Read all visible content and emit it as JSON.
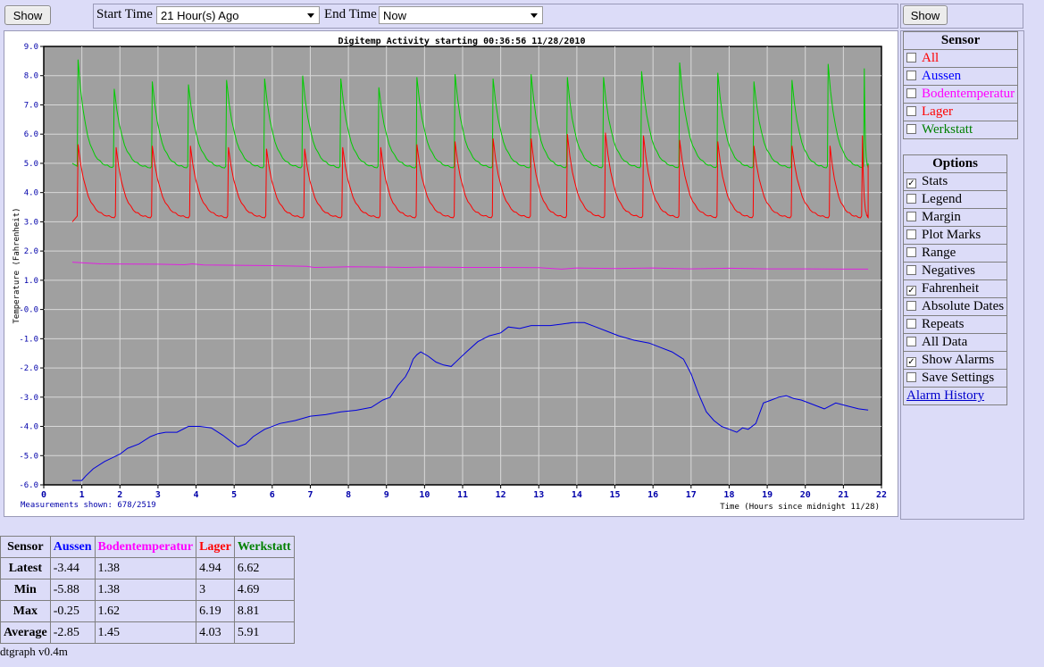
{
  "controls": {
    "show_label": "Show",
    "start_time_label": "Start Time",
    "start_time_value": "21 Hour(s) Ago",
    "end_time_label": "End Time",
    "end_time_value": "Now"
  },
  "sensor_panel": {
    "header": "Sensor",
    "items": [
      {
        "label": "All",
        "color": "#ff0000",
        "checked": false
      },
      {
        "label": "Aussen",
        "color": "#0000ff",
        "checked": false
      },
      {
        "label": "Bodentemperatur",
        "color": "#ff00ff",
        "checked": false
      },
      {
        "label": "Lager",
        "color": "#ff0000",
        "checked": false
      },
      {
        "label": "Werkstatt",
        "color": "#008000",
        "checked": false
      }
    ]
  },
  "options_panel": {
    "header": "Options",
    "items": [
      {
        "label": "Stats",
        "checked": true
      },
      {
        "label": "Legend",
        "checked": false
      },
      {
        "label": "Margin",
        "checked": false
      },
      {
        "label": "Plot Marks",
        "checked": false
      },
      {
        "label": "Range",
        "checked": false
      },
      {
        "label": "Negatives",
        "checked": false
      },
      {
        "label": "Fahrenheit",
        "checked": true
      },
      {
        "label": "Absolute Dates",
        "checked": false
      },
      {
        "label": "Repeats",
        "checked": false
      },
      {
        "label": "All Data",
        "checked": false
      },
      {
        "label": "Show Alarms",
        "checked": true
      },
      {
        "label": "Save Settings",
        "checked": false
      }
    ],
    "alarm_history": "Alarm History"
  },
  "chart_data": {
    "type": "line",
    "title": "Digitemp Activity starting 00:36:56 11/28/2010",
    "xlabel": "Time (Hours since midnight 11/28)",
    "ylabel": "Temperature (Fahrenheit)",
    "footnote": "Measurements shown: 678/2519",
    "xlim": [
      0,
      22
    ],
    "ylim": [
      -6,
      9
    ],
    "xticks": [
      "0",
      "1",
      "2",
      "3",
      "4",
      "5",
      "6",
      "7",
      "8",
      "9",
      "10",
      "11",
      "12",
      "13",
      "14",
      "15",
      "16",
      "17",
      "18",
      "19",
      "20",
      "21",
      "22"
    ],
    "yticks": [
      "-6.0",
      "-5.0",
      "-4.0",
      "-3.0",
      "-2.0",
      "-1.0",
      "-0.0",
      "1.0",
      "2.0",
      "3.0",
      "4.0",
      "5.0",
      "6.0",
      "7.0",
      "8.0",
      "9.0"
    ],
    "grid": true,
    "background": "#a0a0a0",
    "series": [
      {
        "name": "Werkstatt",
        "color": "#00cc00",
        "kind": "sawtooth",
        "peaks": [
          [
            0.9,
            8.55
          ],
          [
            1.85,
            7.55
          ],
          [
            2.85,
            7.8
          ],
          [
            3.8,
            7.7
          ],
          [
            4.8,
            7.85
          ],
          [
            5.8,
            7.9
          ],
          [
            6.8,
            8.0
          ],
          [
            7.8,
            7.9
          ],
          [
            8.8,
            7.6
          ],
          [
            9.8,
            7.95
          ],
          [
            10.8,
            8.05
          ],
          [
            11.8,
            7.9
          ],
          [
            12.8,
            8.05
          ],
          [
            13.75,
            7.95
          ],
          [
            14.7,
            7.95
          ],
          [
            15.7,
            8.15
          ],
          [
            16.7,
            8.45
          ],
          [
            17.7,
            8.1
          ],
          [
            18.65,
            7.8
          ],
          [
            19.65,
            7.85
          ],
          [
            20.6,
            8.4
          ],
          [
            21.55,
            8.25
          ]
        ],
        "start": [
          0.75,
          5.0
        ],
        "base": 4.8,
        "end": [
          21.65,
          5.0
        ]
      },
      {
        "name": "Lager",
        "color": "#ff0000",
        "kind": "sawtooth",
        "peaks": [
          [
            0.9,
            5.65
          ],
          [
            1.9,
            5.55
          ],
          [
            2.85,
            5.6
          ],
          [
            3.85,
            5.6
          ],
          [
            4.85,
            5.55
          ],
          [
            5.85,
            5.5
          ],
          [
            6.85,
            5.5
          ],
          [
            7.85,
            5.55
          ],
          [
            8.85,
            5.55
          ],
          [
            9.8,
            5.65
          ],
          [
            10.8,
            5.75
          ],
          [
            11.8,
            5.85
          ],
          [
            12.8,
            5.85
          ],
          [
            13.75,
            6.0
          ],
          [
            14.75,
            6.05
          ],
          [
            15.75,
            5.95
          ],
          [
            16.7,
            5.8
          ],
          [
            17.7,
            5.75
          ],
          [
            18.65,
            5.6
          ],
          [
            19.65,
            5.6
          ],
          [
            20.65,
            5.6
          ],
          [
            21.5,
            5.95
          ]
        ],
        "start": [
          0.75,
          3.0
        ],
        "base": 3.1,
        "end": [
          21.65,
          4.94
        ]
      },
      {
        "name": "Bodentemperatur",
        "color": "#e020e0",
        "kind": "line",
        "x": [
          0.75,
          1.5,
          3,
          3.7,
          3.9,
          4.2,
          6,
          6.9,
          7.1,
          8,
          9,
          9.5,
          10,
          11,
          12,
          13,
          13.6,
          14,
          15,
          16,
          17,
          18,
          19,
          20,
          21,
          21.65
        ],
        "y": [
          1.62,
          1.56,
          1.55,
          1.53,
          1.56,
          1.52,
          1.5,
          1.48,
          1.44,
          1.46,
          1.45,
          1.44,
          1.45,
          1.44,
          1.44,
          1.43,
          1.38,
          1.42,
          1.4,
          1.42,
          1.39,
          1.41,
          1.39,
          1.39,
          1.38,
          1.38
        ]
      },
      {
        "name": "Aussen",
        "color": "#0000dd",
        "kind": "line",
        "x": [
          0.75,
          1.0,
          1.1,
          1.3,
          1.6,
          2.0,
          2.2,
          2.5,
          2.8,
          3.0,
          3.2,
          3.5,
          3.8,
          4.1,
          4.4,
          4.7,
          4.9,
          5.1,
          5.3,
          5.5,
          5.8,
          6.2,
          6.6,
          7.0,
          7.4,
          7.8,
          8.2,
          8.6,
          8.9,
          9.1,
          9.3,
          9.5,
          9.6,
          9.7,
          9.8,
          9.9,
          10.1,
          10.3,
          10.5,
          10.7,
          10.9,
          11.1,
          11.4,
          11.7,
          12.0,
          12.2,
          12.5,
          12.8,
          13.0,
          13.3,
          13.6,
          13.9,
          14.2,
          14.5,
          14.8,
          15.1,
          15.5,
          15.9,
          16.2,
          16.5,
          16.8,
          17.0,
          17.2,
          17.4,
          17.6,
          17.8,
          18.0,
          18.2,
          18.35,
          18.5,
          18.7,
          18.9,
          19.1,
          19.3,
          19.5,
          19.7,
          19.9,
          20.2,
          20.5,
          20.8,
          21.1,
          21.4,
          21.65
        ],
        "y": [
          -5.85,
          -5.85,
          -5.7,
          -5.45,
          -5.2,
          -4.95,
          -4.75,
          -4.6,
          -4.35,
          -4.25,
          -4.2,
          -4.2,
          -4.0,
          -4.0,
          -4.05,
          -4.3,
          -4.5,
          -4.7,
          -4.6,
          -4.35,
          -4.1,
          -3.9,
          -3.8,
          -3.65,
          -3.6,
          -3.5,
          -3.45,
          -3.35,
          -3.1,
          -3.0,
          -2.6,
          -2.3,
          -2.05,
          -1.7,
          -1.55,
          -1.45,
          -1.6,
          -1.8,
          -1.9,
          -1.95,
          -1.7,
          -1.45,
          -1.1,
          -0.9,
          -0.8,
          -0.6,
          -0.65,
          -0.55,
          -0.55,
          -0.55,
          -0.5,
          -0.45,
          -0.45,
          -0.6,
          -0.75,
          -0.9,
          -1.05,
          -1.15,
          -1.3,
          -1.45,
          -1.7,
          -2.2,
          -2.9,
          -3.5,
          -3.8,
          -4.0,
          -4.1,
          -4.2,
          -4.05,
          -4.1,
          -3.9,
          -3.2,
          -3.1,
          -3.0,
          -2.95,
          -3.05,
          -3.1,
          -3.25,
          -3.4,
          -3.2,
          -3.3,
          -3.4,
          -3.44
        ]
      }
    ]
  },
  "stats_table": {
    "headers": [
      "Sensor",
      "Aussen",
      "Bodentemperatur",
      "Lager",
      "Werkstatt"
    ],
    "header_colors": [
      "#000000",
      "#0000ff",
      "#ff00ff",
      "#ff0000",
      "#008000"
    ],
    "rows": [
      {
        "label": "Latest",
        "values": [
          "-3.44",
          "1.38",
          "4.94",
          "6.62"
        ]
      },
      {
        "label": "Min",
        "values": [
          "-5.88",
          "1.38",
          "3",
          "4.69"
        ]
      },
      {
        "label": "Max",
        "values": [
          "-0.25",
          "1.62",
          "6.19",
          "8.81"
        ]
      },
      {
        "label": "Average",
        "values": [
          "-2.85",
          "1.45",
          "4.03",
          "5.91"
        ]
      }
    ]
  },
  "footer": "dtgraph v0.4m"
}
